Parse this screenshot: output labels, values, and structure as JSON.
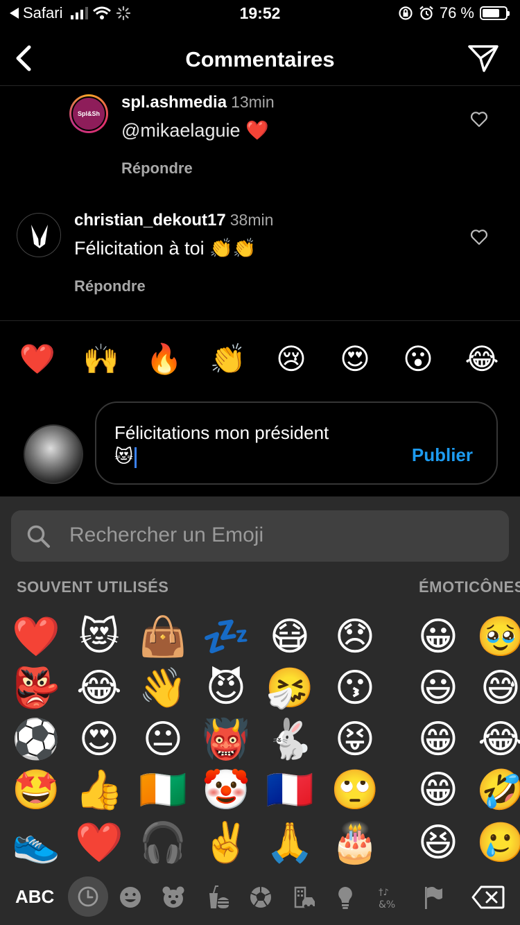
{
  "status_bar": {
    "back_app": "Safari",
    "time": "19:52",
    "battery_percent": "76 %",
    "battery_level": 0.76
  },
  "nav": {
    "title": "Commentaires"
  },
  "comments": [
    {
      "avatar_label": "Spl&Sh",
      "username": "spl.ashmedia",
      "time": "13min",
      "text": "@mikaelaguie ❤️",
      "reply": "Répondre"
    },
    {
      "username": "christian_dekout17",
      "time": "38min",
      "text": "Félicitation à toi 👏👏",
      "reply": "Répondre"
    }
  ],
  "quick_reactions": [
    "❤️",
    "🙌",
    "🔥",
    "👏",
    "😢",
    "😍",
    "😮",
    "😂"
  ],
  "composer": {
    "line1": "Félicitations mon président",
    "line2": "😻",
    "publish": "Publier"
  },
  "keyboard": {
    "search_placeholder": "Rechercher un Emoji",
    "section_frequent": "SOUVENT UTILISÉS",
    "section_smileys": "ÉMOTICÔNES",
    "frequent_columns": [
      [
        "❤️",
        "👺",
        "⚽",
        "🤩",
        "👟"
      ],
      [
        "😻",
        "😂",
        "😍",
        "👍",
        "❤️"
      ],
      [
        "👜",
        "👋",
        "😐",
        "🇨🇮",
        "🎧"
      ],
      [
        "💤",
        "😈",
        "👹",
        "🤡",
        "✌️"
      ],
      [
        "😷",
        "🤧",
        "🐇",
        "🇫🇷",
        "🙏"
      ],
      [
        "😞",
        "😗",
        "😝",
        "🙄",
        "🎂"
      ]
    ],
    "smiley_columns": [
      [
        "😀",
        "😃",
        "😁",
        "😁",
        "😆"
      ],
      [
        "🥹",
        "😅",
        "😂",
        "🤣",
        "🥲"
      ]
    ],
    "abc_label": "ABC",
    "categories": [
      "recent-icon",
      "smiley-icon",
      "animal-icon",
      "food-icon",
      "ball-icon",
      "travel-icon",
      "lightbulb-icon",
      "symbols-icon",
      "flag-icon"
    ]
  }
}
